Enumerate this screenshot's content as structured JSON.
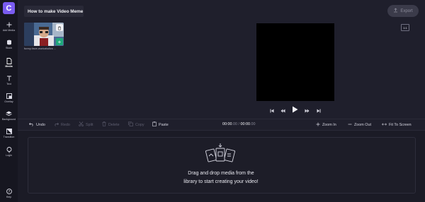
{
  "app": {
    "logo_letter": "C",
    "accent": "#7a5cf0"
  },
  "sidebar": {
    "items": [
      {
        "label": "Add Media",
        "icon": "plus-icon"
      },
      {
        "label": "Stock",
        "icon": "database-icon"
      },
      {
        "label": "Media",
        "icon": "file-icon"
      },
      {
        "label": "Text",
        "icon": "text-icon"
      },
      {
        "label": "Overlay",
        "icon": "overlay-icon"
      },
      {
        "label": "Background",
        "icon": "layers-icon"
      },
      {
        "label": "Transition",
        "icon": "transition-icon"
      },
      {
        "label": "Login",
        "icon": "user-icon"
      },
      {
        "label": "Help",
        "icon": "help-icon"
      }
    ]
  },
  "header": {
    "title": "How to make Video Meme",
    "export_label": "Export"
  },
  "media": {
    "items": [
      {
        "name": "funny-face-workaholics ...",
        "add_label": "+"
      }
    ]
  },
  "preview": {
    "aspect_ratio": "1:1"
  },
  "toolbar": {
    "undo": "Undo",
    "redo": "Redo",
    "split": "Split",
    "delete": "Delete",
    "copy": "Copy",
    "paste": "Paste",
    "zoom_in": "Zoom In",
    "zoom_out": "Zoom Out",
    "fit": "Fit To Screen"
  },
  "timecode": {
    "current": "00:00",
    "current_frac": ".00",
    "separator": " / ",
    "total": "00:00",
    "total_frac": ".00"
  },
  "timeline": {
    "drop_text_line1": "Drag and drop media from the",
    "drop_text_line2": "library to start creating your video!"
  }
}
